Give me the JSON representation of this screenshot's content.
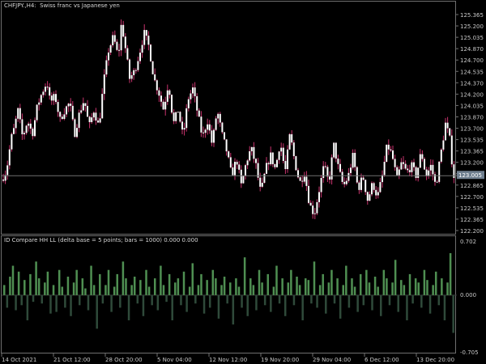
{
  "main_panel": {
    "title": "CHFJPY.,H4:  Swiss franc vs Japanese yen",
    "current_price_label": "123.005"
  },
  "indicator_panel": {
    "title": "ID Compare HH LL (delta base = 5 points; bars = 1000) 0.000 0.000"
  },
  "colors": {
    "background": "#000000",
    "candle_up": "#ffffff",
    "candle_down": "#ffffff",
    "wick": "#c8336e",
    "positive_bar": "#4f8f52",
    "negative_bar": "#2f4a3a",
    "grid_line": "#6f6f6f",
    "price_label_bg": "#6f7f8f"
  },
  "chart_data": [
    {
      "type": "candlestick",
      "title": "CHFJPY.,H4:  Swiss franc vs Japanese yen",
      "ylim": [
        122.15,
        125.5
      ],
      "y_ticks": [
        "125.365",
        "125.200",
        "125.035",
        "124.870",
        "124.700",
        "124.535",
        "124.370",
        "124.200",
        "124.035",
        "123.870",
        "123.700",
        "123.535",
        "123.365",
        "123.200",
        "123.035",
        "122.865",
        "122.700",
        "122.535",
        "122.365",
        "122.200"
      ],
      "current_price": 123.005,
      "close_path": [
        [
          0,
          122.95
        ],
        [
          6,
          123.08
        ],
        [
          12,
          123.55
        ],
        [
          16,
          123.7
        ],
        [
          20,
          123.95
        ],
        [
          26,
          123.55
        ],
        [
          32,
          123.8
        ],
        [
          38,
          123.6
        ],
        [
          44,
          124.0
        ],
        [
          50,
          124.2
        ],
        [
          56,
          124.35
        ],
        [
          60,
          124.05
        ],
        [
          66,
          124.15
        ],
        [
          72,
          123.8
        ],
        [
          78,
          123.95
        ],
        [
          84,
          124.05
        ],
        [
          90,
          123.6
        ],
        [
          96,
          123.9
        ],
        [
          102,
          124.1
        ],
        [
          108,
          123.7
        ],
        [
          114,
          123.95
        ],
        [
          120,
          123.7
        ],
        [
          126,
          124.35
        ],
        [
          132,
          124.8
        ],
        [
          138,
          125.0
        ],
        [
          144,
          124.7
        ],
        [
          148,
          125.2
        ],
        [
          152,
          124.9
        ],
        [
          158,
          124.4
        ],
        [
          164,
          124.5
        ],
        [
          170,
          124.75
        ],
        [
          176,
          125.05
        ],
        [
          182,
          124.85
        ],
        [
          188,
          124.4
        ],
        [
          194,
          124.2
        ],
        [
          200,
          123.95
        ],
        [
          206,
          124.35
        ],
        [
          212,
          123.75
        ],
        [
          218,
          123.95
        ],
        [
          224,
          123.55
        ],
        [
          230,
          124.1
        ],
        [
          236,
          124.25
        ],
        [
          242,
          123.9
        ],
        [
          248,
          123.55
        ],
        [
          254,
          123.8
        ],
        [
          260,
          123.45
        ],
        [
          266,
          123.95
        ],
        [
          272,
          123.6
        ],
        [
          278,
          123.35
        ],
        [
          284,
          123.0
        ],
        [
          290,
          123.25
        ],
        [
          296,
          122.85
        ],
        [
          302,
          123.2
        ],
        [
          308,
          123.4
        ],
        [
          314,
          123.15
        ],
        [
          320,
          122.75
        ],
        [
          326,
          123.1
        ],
        [
          332,
          123.3
        ],
        [
          338,
          123.1
        ],
        [
          344,
          123.5
        ],
        [
          350,
          123.05
        ],
        [
          356,
          123.6
        ],
        [
          362,
          123.2
        ],
        [
          368,
          122.9
        ],
        [
          374,
          123.05
        ],
        [
          380,
          122.6
        ],
        [
          386,
          122.45
        ],
        [
          392,
          122.8
        ],
        [
          398,
          123.15
        ],
        [
          404,
          122.9
        ],
        [
          410,
          123.45
        ],
        [
          416,
          123.1
        ],
        [
          422,
          122.85
        ],
        [
          428,
          123.0
        ],
        [
          434,
          123.3
        ],
        [
          440,
          122.8
        ],
        [
          446,
          123.0
        ],
        [
          452,
          122.65
        ],
        [
          458,
          122.9
        ],
        [
          464,
          122.7
        ],
        [
          470,
          123.0
        ],
        [
          476,
          123.45
        ],
        [
          482,
          123.3
        ],
        [
          488,
          122.95
        ],
        [
          494,
          123.2
        ],
        [
          500,
          123.05
        ],
        [
          506,
          123.15
        ],
        [
          512,
          123.0
        ],
        [
          518,
          123.35
        ],
        [
          524,
          123.0
        ],
        [
          530,
          123.15
        ],
        [
          536,
          122.85
        ],
        [
          542,
          123.3
        ],
        [
          548,
          123.75
        ],
        [
          553,
          123.55
        ],
        [
          556,
          123.2
        ],
        [
          559,
          122.95
        ]
      ]
    },
    {
      "type": "bar",
      "title": "ID Compare HH LL (delta base = 5 points; bars = 1000) 0.000 0.000",
      "ylim": [
        -0.705,
        0.702
      ],
      "y_ticks": [
        "0.702",
        "0.000",
        "-0.705"
      ],
      "values": [
        0.12,
        -0.15,
        0.22,
        0.35,
        -0.18,
        0.28,
        -0.12,
        0.18,
        -0.3,
        0.25,
        -0.08,
        0.4,
        0.2,
        -0.1,
        0.15,
        0.28,
        -0.22,
        0.12,
        -0.2,
        0.3,
        0.1,
        -0.15,
        0.22,
        -0.25,
        0.15,
        0.3,
        -0.12,
        0.2,
        0.08,
        -0.18,
        0.35,
        0.12,
        -0.4,
        0.25,
        -0.1,
        0.12,
        0.3,
        -0.2,
        0.1,
        0.25,
        -0.15,
        0.4,
        0.2,
        -0.3,
        0.12,
        0.22,
        -0.1,
        0.18,
        -0.25,
        0.3,
        0.1,
        -0.12,
        0.2,
        -0.18,
        0.35,
        0.12,
        -0.08,
        0.25,
        -0.3,
        0.15,
        0.2,
        -0.12,
        0.28,
        -0.2,
        0.1,
        0.38,
        -0.1,
        0.12,
        0.25,
        -0.22,
        0.18,
        -0.15,
        0.3,
        0.2,
        -0.28,
        0.12,
        0.22,
        -0.1,
        0.15,
        -0.35,
        0.2,
        0.1,
        -0.15,
        0.45,
        -0.25,
        0.2,
        0.12,
        -0.18,
        0.3,
        0.15,
        -0.12,
        0.25,
        -0.2,
        0.1,
        0.35,
        -0.1,
        0.2,
        -0.25,
        0.15,
        0.3,
        -0.12,
        0.22,
        0.12,
        -0.3,
        0.2,
        0.18,
        -0.1,
        0.4,
        -0.15,
        0.12,
        0.25,
        -0.22,
        0.15,
        0.3,
        -0.1,
        0.2,
        -0.28,
        0.12,
        0.35,
        -0.15,
        0.2,
        0.1,
        -0.2,
        0.25,
        -0.12,
        0.3,
        0.15,
        -0.18,
        0.22,
        0.1,
        -0.25,
        0.3,
        0.2,
        -0.12,
        0.15,
        0.42,
        -0.2,
        0.18,
        0.12,
        -0.3,
        0.25,
        -0.1,
        0.2,
        0.15,
        -0.15,
        0.3,
        0.18,
        -0.22,
        0.12,
        0.28,
        -0.12,
        0.2,
        -0.3,
        0.15,
        0.5,
        -0.45
      ]
    }
  ],
  "time_axis": {
    "labels": [
      "14 Oct 2021",
      "21 Oct 12:00",
      "28 Oct 20:00",
      "5 Nov 04:00",
      "12 Nov 12:00",
      "19 Nov 20:00",
      "29 Nov 04:00",
      "6 Dec 12:00",
      "13 Dec 20:00"
    ]
  }
}
